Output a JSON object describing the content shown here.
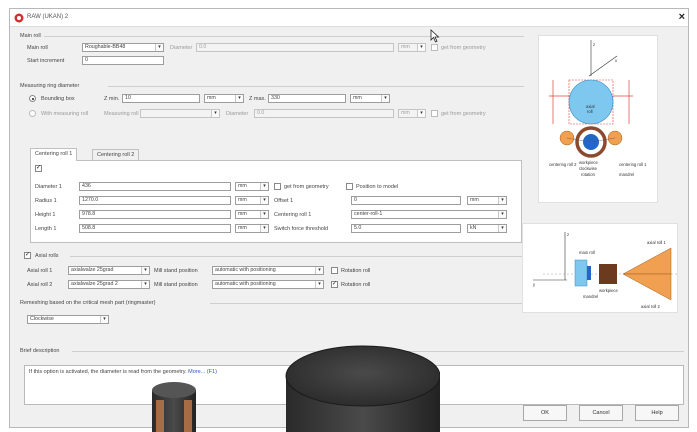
{
  "window": {
    "title": "RAW (UKAN) 2"
  },
  "main_roll": {
    "section_title": "Main roll",
    "roll_label": "Main roll",
    "roll_value": "Roughable-BB48",
    "diameter_label": "Diameter",
    "diameter_value": "0.0",
    "diameter_unit": "mm",
    "get_from_geometry_label": "get from geometry",
    "start_increment_label": "Start increment",
    "start_increment_value": "0"
  },
  "measuring": {
    "section_title": "Measuring ring diameter",
    "bounding_box_label": "Bounding box",
    "zmin_label": "Z min.",
    "zmin_value": "10",
    "zmin_unit": "mm",
    "zmax_label": "Z max.",
    "zmax_value": "330",
    "zmax_unit": "mm",
    "with_measuring_roll_label": "With measuring roll",
    "measuring_roll_label": "Measuring roll",
    "measuring_roll_value": "",
    "diameter_label": "Diameter",
    "diameter_value": "0.0",
    "diameter_unit": "mm",
    "get_from_geometry_label": "get from geometry"
  },
  "tabs": [
    {
      "label": "Centering roll 1"
    },
    {
      "label": "Centering roll 2"
    }
  ],
  "centering": {
    "enabled_check": "✓",
    "diameter_label": "Diameter 1",
    "diameter_value": "436",
    "diameter_unit": "mm",
    "get_from_geometry_label": "get from geometry",
    "position_to_model_label": "Position to model",
    "radius_label": "Radius 1",
    "radius_value": "1270.0",
    "radius_unit": "mm",
    "offset_label": "Offset 1",
    "offset_value": "0",
    "offset_unit": "mm",
    "height_label": "Height 1",
    "height_value": "978.8",
    "height_unit": "mm",
    "centering_roll_label": "Centering roll 1",
    "centering_roll_value": "center-roll-1",
    "length_label": "Length 1",
    "length_value": "508.8",
    "length_unit": "mm",
    "switch_force_label": "Switch force threshold",
    "switch_force_value": "5.0",
    "switch_force_unit": "kN"
  },
  "axial_rolls": {
    "enabled_check": "✓",
    "section_title": "Axial rolls",
    "rows": [
      {
        "label": "Axial roll 1",
        "value": "axialwalze 25grad",
        "mill_stand_label": "Mill stand position",
        "mill_stand_value": "automatic with positioning",
        "rotation_label": "Rotation roll",
        "rotation_checked": ""
      },
      {
        "label": "Axial roll 2",
        "value": "axialwalze 25grad 2",
        "mill_stand_label": "Mill stand position",
        "mill_stand_value": "automatic with positioning",
        "rotation_label": "Rotation roll",
        "rotation_checked": "✓"
      }
    ]
  },
  "remeshing": {
    "section_title": "Remeshing based on the critical mesh part (ringmaster)",
    "value": "Clockwise"
  },
  "brief": {
    "section_title": "Brief description",
    "text": "If this option is activated, the diameter is read from the geometry.",
    "link": "More... (F1)"
  },
  "buttons": {
    "ok": "OK",
    "cancel": "Cancel",
    "help": "Help"
  },
  "figure_top": {
    "labels": {
      "axial": "axial",
      "roll": "roll",
      "centering_roll_2": "centering roll 2",
      "centering_roll_1": "centering roll 1",
      "workpiece": "workpiece",
      "clockwise": "clockwise",
      "rotation": "rotation",
      "mandrel": "mandrel",
      "z": "z",
      "x": "x"
    },
    "colors": {
      "roll_blue": "#7ec7ee",
      "workpiece": "#8b4a2f",
      "dims": "#e0403a",
      "centering": "#f0a050"
    }
  },
  "figure_side": {
    "labels": {
      "main_roll": "main roll",
      "axial_roll_1": "axial roll 1",
      "axial_roll_2": "axial roll 2",
      "workpiece": "workpiece",
      "mandrel": "mandrel",
      "z": "z",
      "y": "y"
    },
    "colors": {
      "axial": "#f0a050",
      "workpiece": "#6b3a1f",
      "roll": "#7ec7ee"
    }
  }
}
